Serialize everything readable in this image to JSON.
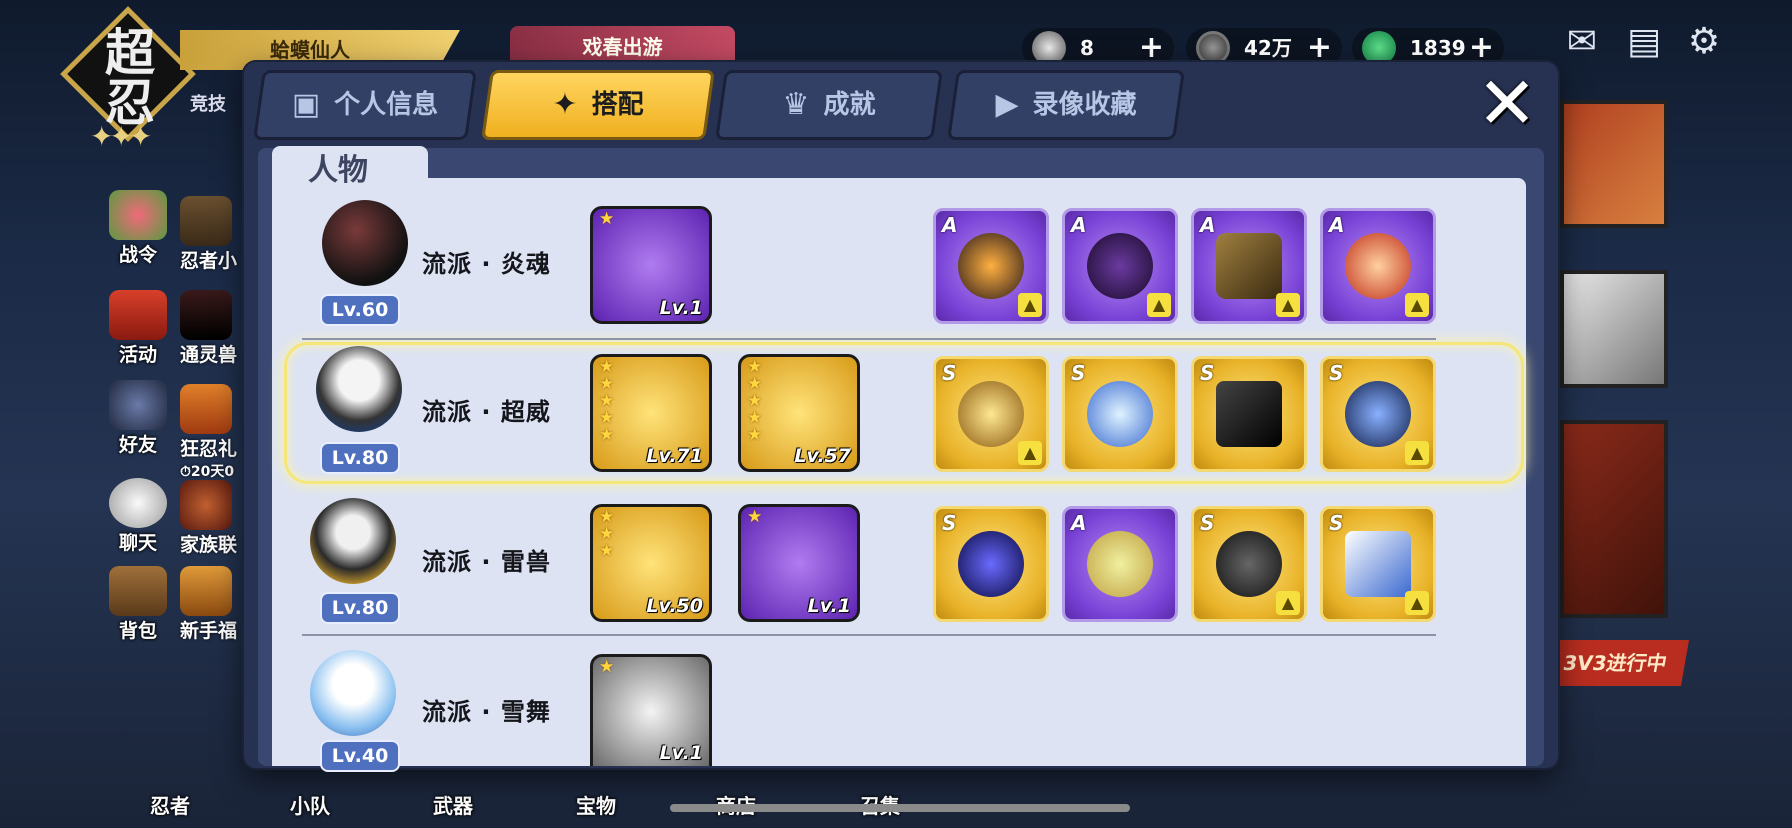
{
  "hud": {
    "logo_top": "超",
    "logo_bottom": "忍",
    "logo_stars": "✦✦✦",
    "player_name": "蛤蟆仙人",
    "arena_label": "竞技",
    "event_label": "戏春出游",
    "resources": [
      {
        "icon": "rice-ball-icon",
        "value": "8"
      },
      {
        "icon": "coin-icon",
        "value": "42万"
      },
      {
        "icon": "jade-icon",
        "value": "1839"
      }
    ],
    "plus_symbol": "+",
    "top_icons": [
      "mail-icon",
      "notice-board-icon",
      "gear-icon"
    ],
    "side_menu": [
      "战令",
      "活动",
      "好友",
      "聊天",
      "背包"
    ],
    "side_menu_2": [
      "忍者小",
      "通灵兽",
      "狂忍礼",
      "家族联",
      "新手福"
    ],
    "limited_timer": "⏱20天0",
    "bottom_menu": [
      "忍者",
      "小队",
      "武器",
      "宝物",
      "商店",
      "召集"
    ],
    "banner": "3V3进行中"
  },
  "modal": {
    "tabs": [
      {
        "label": "个人信息",
        "icon": "profile-card-icon",
        "active": false
      },
      {
        "label": "搭配",
        "icon": "shuriken-icon",
        "active": true
      },
      {
        "label": "成就",
        "icon": "trophy-icon",
        "active": false
      },
      {
        "label": "录像收藏",
        "icon": "play-icon",
        "active": false
      }
    ],
    "close_symbol": "✕",
    "section_title": "人物",
    "rows": [
      {
        "portrait": "dark-orb-ninja-portrait",
        "level": "Lv.60",
        "school": "流派 · 炎魂",
        "selected": false,
        "weapons": [
          {
            "name": "jade-flute-weapon",
            "stars": "★",
            "level": "Lv.1",
            "bg": "purple"
          }
        ],
        "gear": [
          {
            "rank": "A",
            "name": "flame-ring-icon",
            "badge": true
          },
          {
            "rank": "A",
            "name": "purple-mask-icon",
            "badge": true
          },
          {
            "rank": "A",
            "name": "bracer-icon",
            "badge": true
          },
          {
            "rank": "A",
            "name": "daruma-doll-icon",
            "badge": true
          }
        ]
      },
      {
        "portrait": "panda-masked-ninja-portrait",
        "level": "Lv.80",
        "school": "流派 · 超威",
        "selected": true,
        "weapons": [
          {
            "name": "purple-scythe-weapon",
            "stars": "★★★★★",
            "level": "Lv.71",
            "bg": "gold"
          },
          {
            "name": "tomoe-shield-weapon",
            "stars": "★★★★★",
            "level": "Lv.57",
            "bg": "gold"
          }
        ],
        "gear": [
          {
            "rank": "S",
            "name": "golden-beast-icon",
            "badge": true
          },
          {
            "rank": "S",
            "name": "ice-crystal-icon",
            "badge": false
          },
          {
            "rank": "S",
            "name": "black-scroll-icon",
            "badge": false
          },
          {
            "rank": "S",
            "name": "blue-ring-icon",
            "badge": true
          }
        ]
      },
      {
        "portrait": "raccoon-ninja-portrait",
        "level": "Lv.80",
        "school": "流派 · 雷兽",
        "selected": false,
        "weapons": [
          {
            "name": "crescent-blade-weapon",
            "stars": "★★★",
            "level": "Lv.50",
            "bg": "gold"
          },
          {
            "name": "meat-club-weapon",
            "stars": "★",
            "level": "Lv.1",
            "bg": "purple"
          }
        ],
        "gear": [
          {
            "rank": "S",
            "name": "dark-orb-icon",
            "badge": false
          },
          {
            "rank": "A",
            "name": "dango-plate-icon",
            "badge": false
          },
          {
            "rank": "S",
            "name": "black-goggles-icon",
            "badge": true
          },
          {
            "rank": "S",
            "name": "charm-tag-icon",
            "badge": true
          }
        ]
      },
      {
        "portrait": "snow-girl-portrait",
        "level": "Lv.40",
        "school": "流派 · 雪舞",
        "selected": false,
        "weapons": [
          {
            "name": "katana-weapon",
            "stars": "★",
            "level": "Lv.1",
            "bg": "silver"
          }
        ],
        "gear": []
      }
    ]
  },
  "colors": {
    "tab_active": "#f0b020",
    "selection_glow": "#f4e67a",
    "rank_a": "#7841d6",
    "rank_s": "#e8b228",
    "level_badge": "#4f6fbf"
  }
}
